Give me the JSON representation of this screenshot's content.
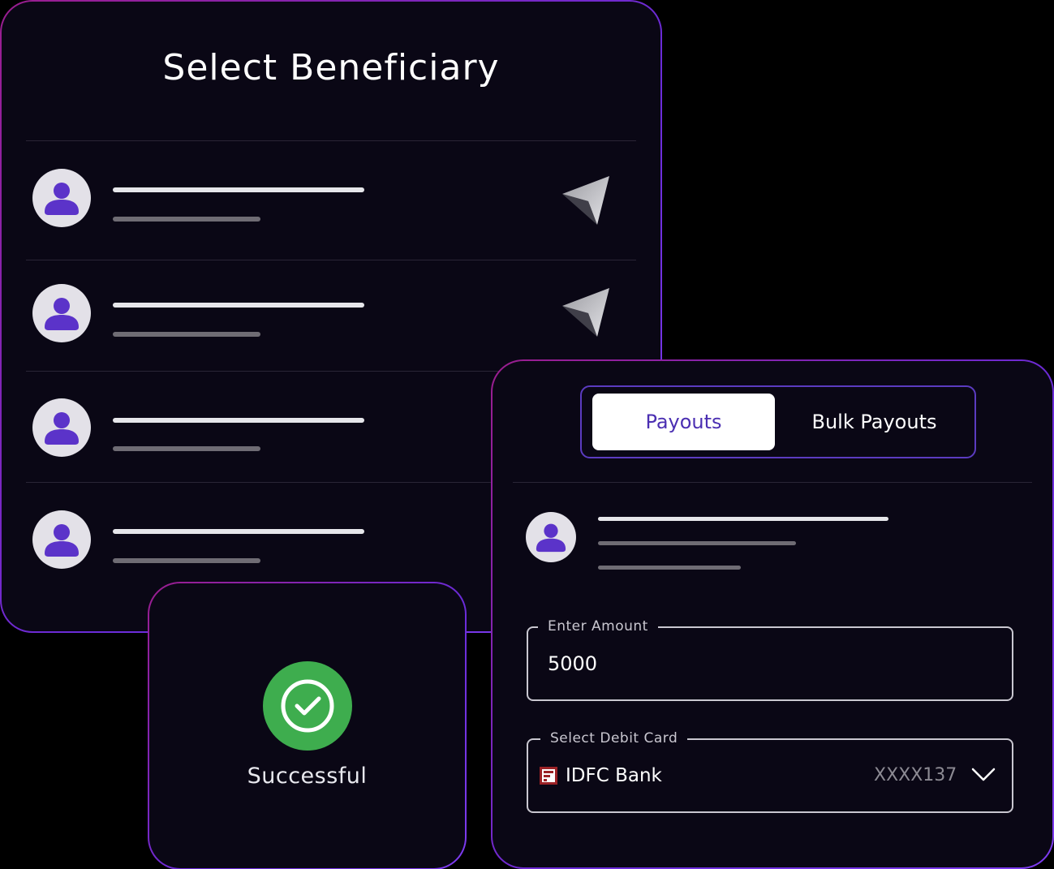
{
  "beneficiary": {
    "title": "Select Beneficiary",
    "rows": [
      {
        "icon": "user-icon",
        "action_icon": "send-icon"
      },
      {
        "icon": "user-icon",
        "action_icon": "send-icon"
      },
      {
        "icon": "user-icon"
      },
      {
        "icon": "user-icon"
      }
    ]
  },
  "status": {
    "label": "Successful",
    "icon": "check-circle-icon",
    "color": "#3ead4e"
  },
  "payout": {
    "tabs": [
      {
        "label": "Payouts",
        "active": true
      },
      {
        "label": "Bulk Payouts",
        "active": false
      }
    ],
    "amount_field": {
      "label": "Enter Amount",
      "value": "5000"
    },
    "card_field": {
      "label": "Select Debit Card",
      "bank_name": "IDFC Bank",
      "card_number": "XXXX137",
      "bank_icon": "idfc-logo-icon",
      "dropdown_icon": "chevron-down-icon"
    }
  },
  "colors": {
    "background": "#0a0715",
    "accent": "#4b2fb2",
    "border_gradient": [
      "#9b1d8e",
      "#7e3cf0"
    ],
    "avatar_bg": "#e3e1e8",
    "avatar_fg": "#5b33c9"
  }
}
